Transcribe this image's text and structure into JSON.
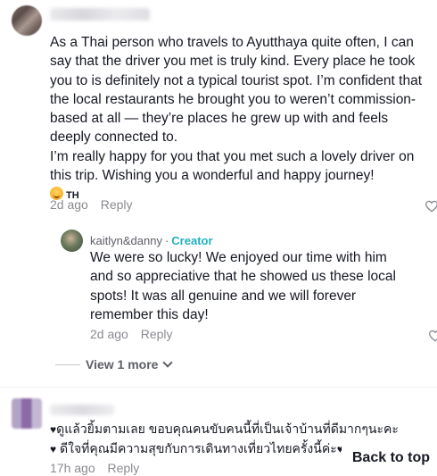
{
  "comments": [
    {
      "lines": [
        "As a Thai person who travels to Ayutthaya quite often, I can say that the driver you met is truly kind. Every place he took you to is definitely not a typical tourist spot. I’m confident that the local restaurants he brought you to weren’t commission-based at all — they’re places he grew up with and feels deeply connected to.",
        "I’m really happy for you that you met such a lovely driver on this trip. Wishing you a wonderful and happy journey!"
      ],
      "suffix": "TH",
      "time": "2d ago",
      "reply_label": "Reply",
      "replies": [
        {
          "author": "kaitlyn&danny",
          "separator": "·",
          "badge": "Creator",
          "text": "We were so lucky! We enjoyed our time with him and so appreciative that he showed us these local spots! It was all genuine and we will forever remember this day!",
          "time": "2d ago",
          "reply_label": "Reply"
        }
      ],
      "view_more_label": "View 1 more"
    },
    {
      "lines": [
        "ดูแล้วยิ้มตามเลย ขอบคุณคนขับคนนี้ที่เป็นเจ้าบ้านที่ดีมากๆนะคะ",
        "ดีใจที่คุณมีความสุขกับการเดินทางเที่ยวไทยครั้งนี้ค่ะ"
      ],
      "time": "17h ago",
      "reply_label": "Reply"
    }
  ],
  "back_to_top_label": "Back to top",
  "colors": {
    "creator": "#20b2bd",
    "meta": "#8a8b91",
    "text": "#161823"
  }
}
